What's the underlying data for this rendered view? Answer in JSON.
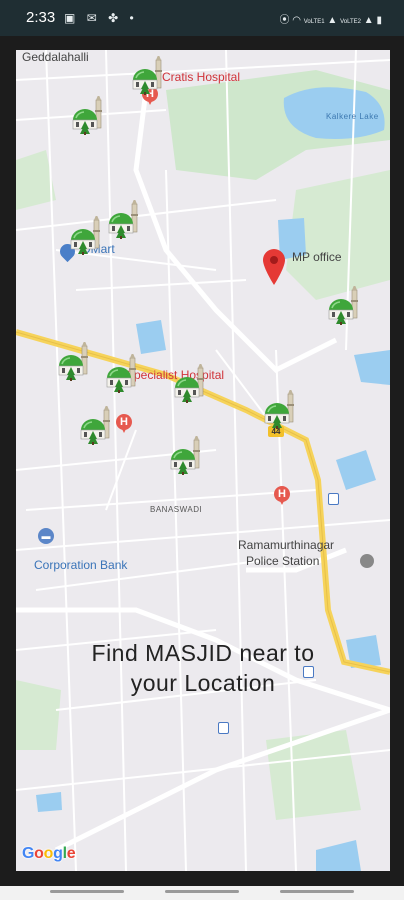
{
  "status_bar": {
    "time": "2:33",
    "left_icons": [
      "image-icon",
      "mail-icon",
      "fan-icon",
      "dot-icon"
    ],
    "right_icons": [
      "location-icon",
      "wifi-icon",
      "signal-icon",
      "signal-icon",
      "battery-icon"
    ],
    "network_labels": [
      "VoLTE1",
      "VoLTE2"
    ]
  },
  "map": {
    "places": {
      "geddalahalli": "Geddalahalli",
      "cratis_hospital": "Cratis Hospital",
      "dmart": "DMart",
      "mp_office": "MP office",
      "specialist_hospital": "Specialist Hospital",
      "banaswadi": "BANASWADI",
      "corporation_bank": "Corporation Bank",
      "police_station_line1": "Ramamurthinagar",
      "police_station_line2": "Police Station",
      "kalkere_lake": "Kalkere Lake",
      "highway_shield": "44"
    },
    "marker_count": 11,
    "colors": {
      "land": "#eceaee",
      "park": "#cfe7cc",
      "water": "#9bcdf0",
      "highway": "#f6d35a",
      "mosque_dome": "#3fa63b",
      "pin_red": "#e53935"
    }
  },
  "headline": {
    "line1": "Find MASJID near to",
    "line2": "your Location"
  },
  "attribution": {
    "letters": [
      "G",
      "o",
      "o",
      "g",
      "l",
      "e"
    ],
    "colors": [
      "#4285f4",
      "#ea4335",
      "#fbbc05",
      "#4285f4",
      "#34a853",
      "#ea4335"
    ]
  }
}
